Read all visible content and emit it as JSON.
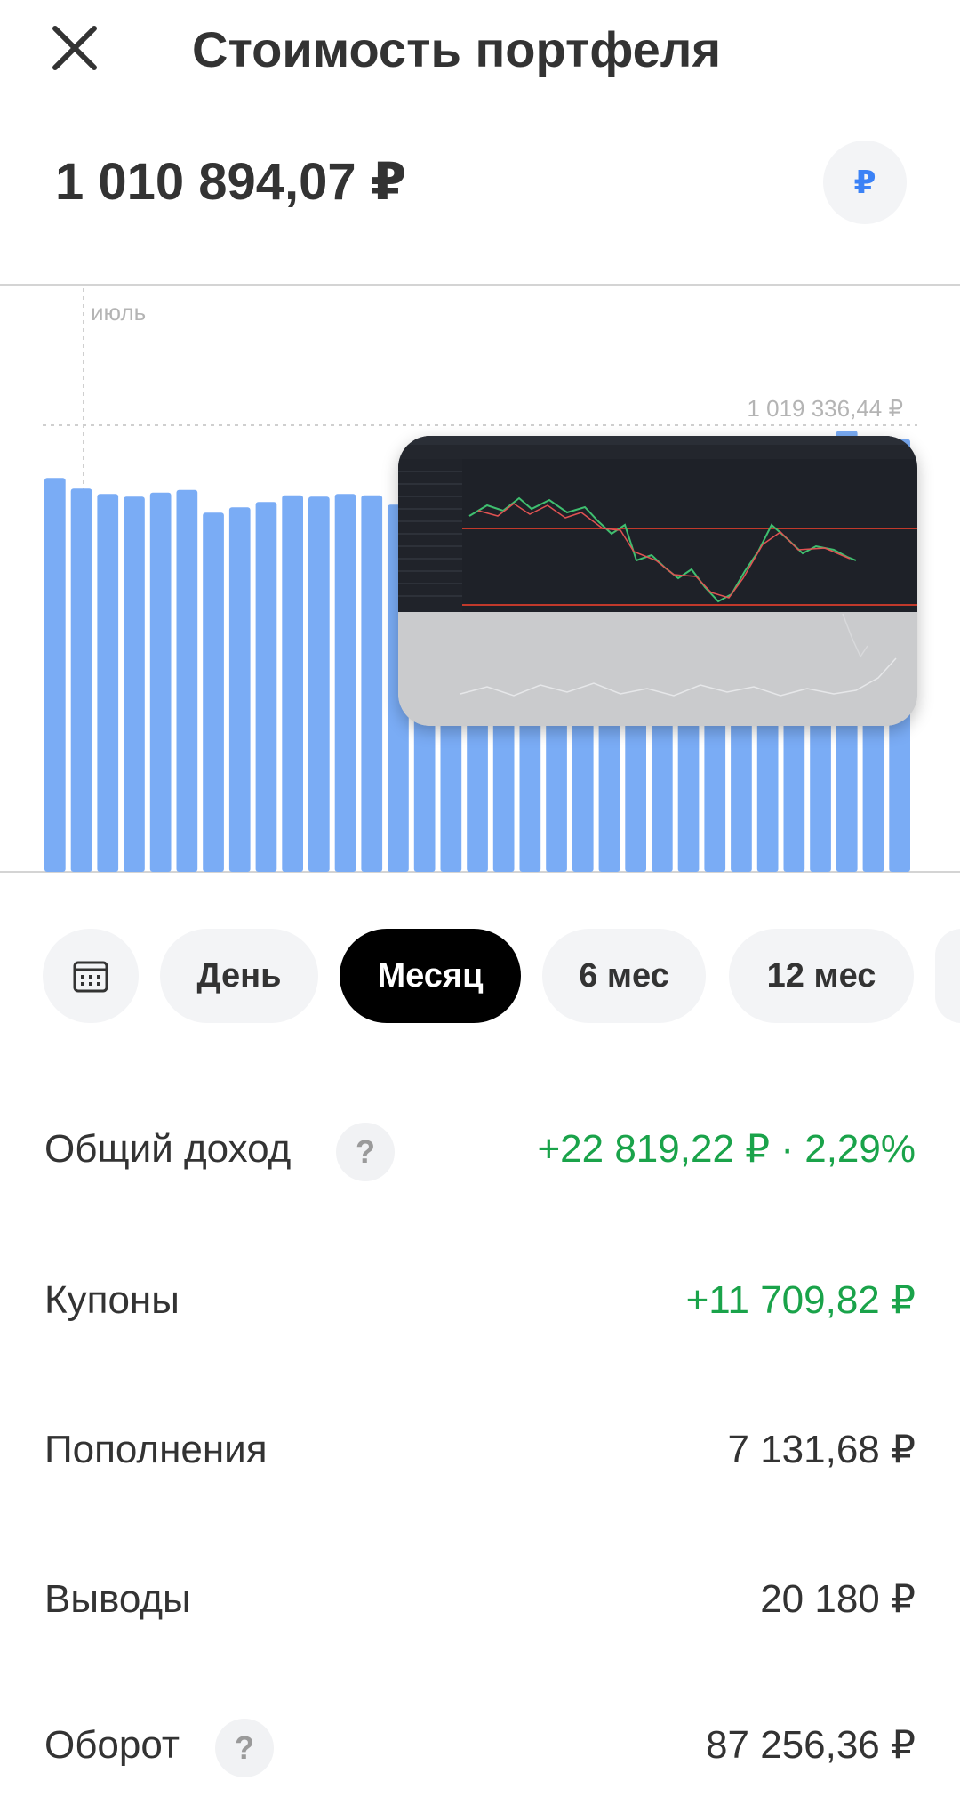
{
  "header": {
    "title": "Стоимость портфеля",
    "close_icon": "close-icon"
  },
  "portfolio": {
    "total_value": "1 010 894,07 ₽",
    "currency_symbol": "₽"
  },
  "chart_data": {
    "type": "bar",
    "month_label": "июль",
    "max_label": "1 019 336,44 ₽",
    "max_value": 1019336.44,
    "values": [
      1015800,
      1015000,
      1014600,
      1014400,
      1014700,
      1014900,
      1013200,
      1013600,
      1014000,
      1014500,
      1014400,
      1014600,
      1014500,
      1013800,
      1014300,
      1015000,
      1015300,
      1015600,
      1015900,
      1016400,
      1016700,
      1017100,
      1017500,
      1017900,
      1018300,
      1018400,
      1018100,
      1018500,
      1017800,
      1018300,
      1019336.44,
      1018000,
      1018700
    ],
    "bar_color": "#7aacf5"
  },
  "periods": {
    "calendar_icon": "calendar-icon",
    "items": [
      "День",
      "Месяц",
      "6 мес",
      "12 мес"
    ],
    "active": "Месяц"
  },
  "stats": {
    "total_income": {
      "label": "Общий доход",
      "value": "+22 819,22 ₽ · 2,29%",
      "help": "?"
    },
    "coupons": {
      "label": "Купоны",
      "value": "+11 709,82 ₽"
    },
    "deposits": {
      "label": "Пополнения",
      "value": "7 131,68 ₽"
    },
    "withdrawals": {
      "label": "Выводы",
      "value": "20 180 ₽"
    },
    "turnover": {
      "label": "Оборот",
      "value": "87 256,36 ₽",
      "help": "?"
    }
  },
  "colors": {
    "positive": "#1aa34a",
    "accent": "#3b82f6",
    "active_pill": "#000000"
  }
}
